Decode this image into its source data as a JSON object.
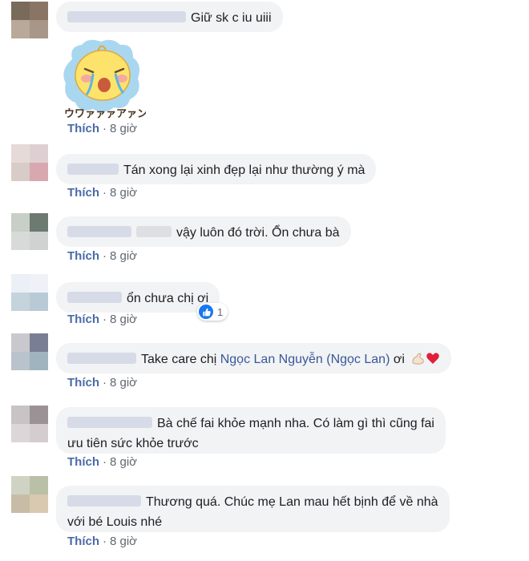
{
  "comments": [
    {
      "text": "Giữ sk c iu uiii",
      "time": "8 giờ",
      "like": "Thích"
    },
    {
      "sticker_text": "ウワァァァアァン!!",
      "time": "8 giờ",
      "like": "Thích"
    },
    {
      "text": "Tán xong lại xinh đẹp lại như thường ý mà",
      "time": "8 giờ",
      "like": "Thích"
    },
    {
      "text": "vậy luôn đó trời. Ổn chưa bà",
      "time": "8 giờ",
      "like": "Thích"
    },
    {
      "text": "ổn chưa chị ơi",
      "time": "8 giờ",
      "like": "Thích",
      "reaction_count": "1"
    },
    {
      "text_before": "Take care chị ",
      "mention": "Ngọc Lan Nguyễn (Ngọc Lan)",
      "text_after": " ơi",
      "time": "8 giờ",
      "like": "Thích"
    },
    {
      "line1": "Bà chế fai khỏe mạnh nha. Có làm gì thì cũng fai",
      "line2": "ưu tiên sức khỏe trước",
      "time": "8 giờ",
      "like": "Thích"
    },
    {
      "line1": "Thương quá. Chúc mẹ Lan mau hết bịnh để về nhà",
      "line2": "với bé Louis nhé",
      "time": "8 giờ",
      "like": "Thích"
    }
  ],
  "separator": "·",
  "colors": {
    "link": "#385898",
    "bubble": "#f2f3f5",
    "like_blue": "#1877f2"
  },
  "icons": [
    "like-reaction-icon",
    "flexed-biceps-icon",
    "red-heart-icon",
    "crying-chick-sticker"
  ]
}
